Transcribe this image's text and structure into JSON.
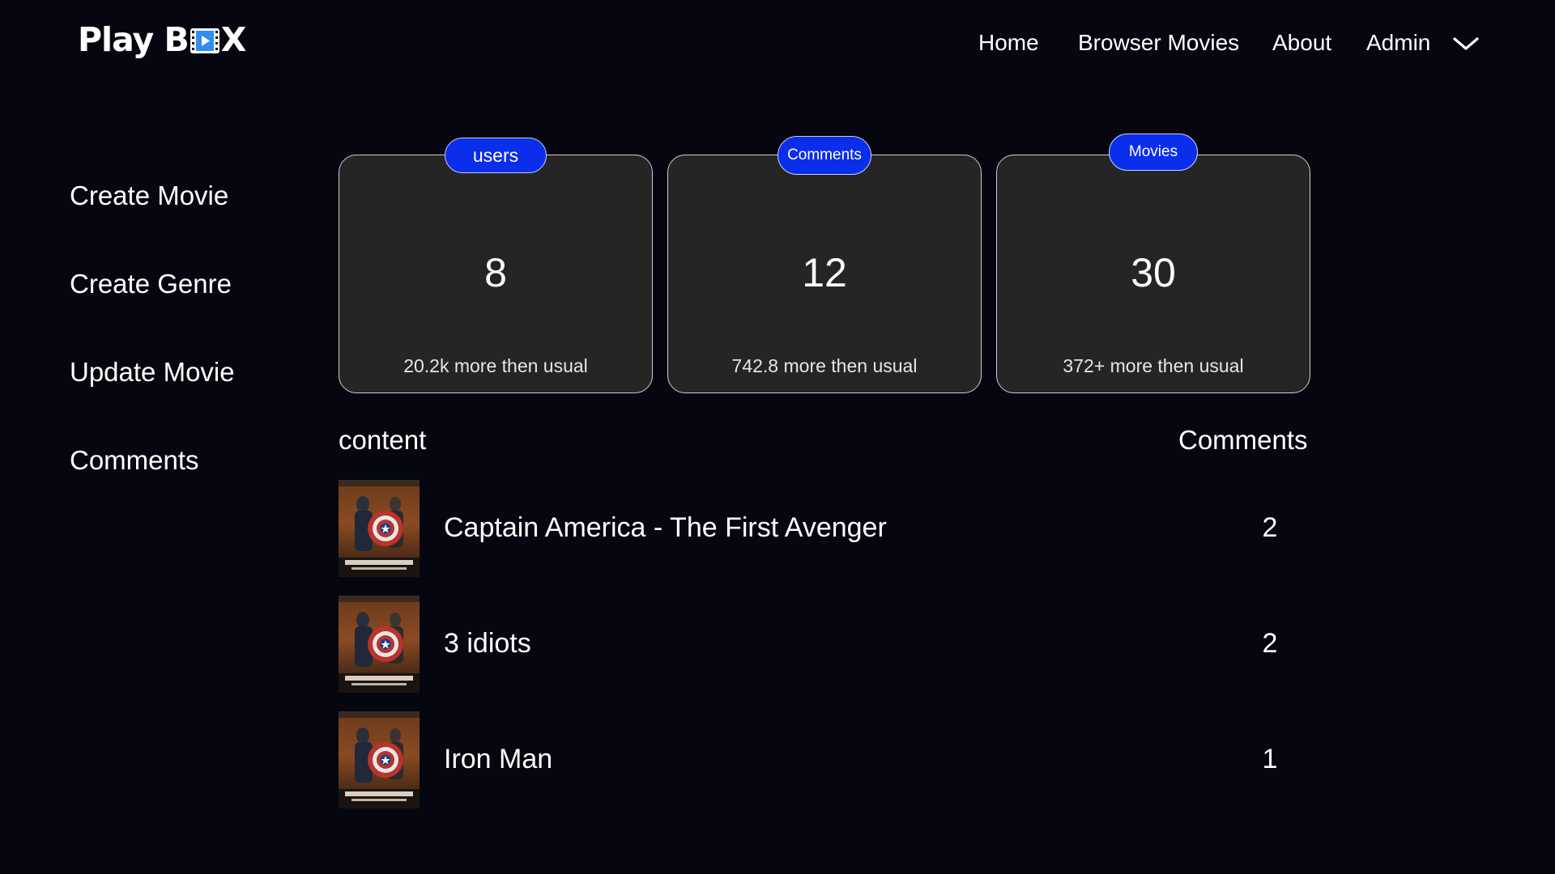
{
  "header": {
    "logo_pre": "Play B",
    "logo_post": "X",
    "nav": {
      "home": "Home",
      "browse": "Browser Movies",
      "about": "About",
      "admin": "Admin"
    }
  },
  "sidebar": {
    "items": [
      {
        "label": "Create Movie"
      },
      {
        "label": "Create Genre"
      },
      {
        "label": "Update Movie"
      },
      {
        "label": "Comments"
      }
    ]
  },
  "stats": [
    {
      "badge": "users",
      "value": "8",
      "note": "20.2k more then usual"
    },
    {
      "badge": "Comments",
      "value": "12",
      "note": "742.8 more then usual"
    },
    {
      "badge": "Movies",
      "value": "30",
      "note": "372+ more then usual"
    }
  ],
  "table": {
    "headers": {
      "content": "content",
      "comments": "Comments"
    },
    "rows": [
      {
        "title": "Captain America - The First Avenger",
        "comments": "2"
      },
      {
        "title": "3 idiots",
        "comments": "2"
      },
      {
        "title": "Iron Man",
        "comments": "1"
      }
    ]
  },
  "colors": {
    "background": "#05060f",
    "card": "#252525",
    "accent": "#0a2eea"
  },
  "icons": {
    "logo": "film-play-icon",
    "admin_menu": "chevron-down-icon",
    "poster": "movie-poster-image"
  }
}
